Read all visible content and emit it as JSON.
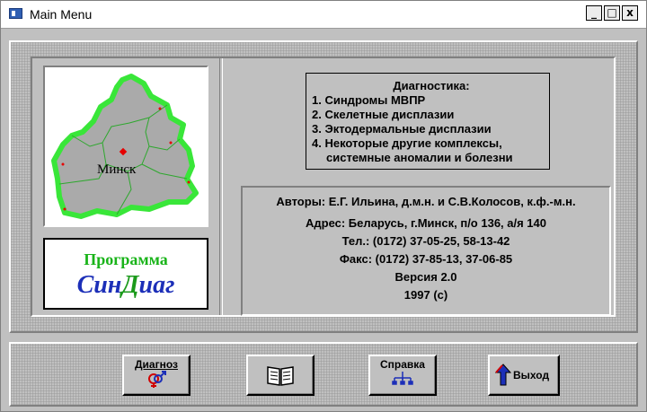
{
  "window": {
    "title": "Main Menu",
    "controls": {
      "minimize": "_",
      "maximize": "□",
      "close": "x"
    }
  },
  "map": {
    "city_label": "Минск"
  },
  "logo": {
    "line1": "Программа",
    "line2_a": "Син",
    "line2_b": "Д",
    "line2_c": "иаг"
  },
  "diagnostics": {
    "heading": "Диагностика:",
    "items": [
      "1. Синдромы МВПР",
      "2. Скелетные дисплазии",
      "3. Эктодермальные дисплазии",
      "4. Некоторые другие комплексы,",
      "    системные аномалии и болезни"
    ]
  },
  "info": {
    "authors": "Авторы: Е.Г. Ильина, д.м.н. и С.В.Колосов, к.ф.-м.н.",
    "address": "Адрес: Беларусь, г.Минск, п/о 136, а/я 140",
    "phone": "Тел.: (0172) 37-05-25, 58-13-42",
    "fax": "Факс: (0172) 37-85-13, 37-06-85",
    "version": "Версия  2.0",
    "year": "1997 (c)"
  },
  "buttons": {
    "diagnosis": "Диагноз",
    "book": "",
    "help": "Справка",
    "exit": "Выход"
  },
  "colors": {
    "map_border": "#39e639",
    "map_fill": "#aaaaaa",
    "logo_green": "#1ab41a",
    "logo_blue": "#1c2fb8"
  },
  "icons": {
    "diagnosis": "gender-symbols-icon",
    "book": "open-book-icon",
    "help": "org-chart-icon",
    "exit": "arrow-exit-icon"
  }
}
